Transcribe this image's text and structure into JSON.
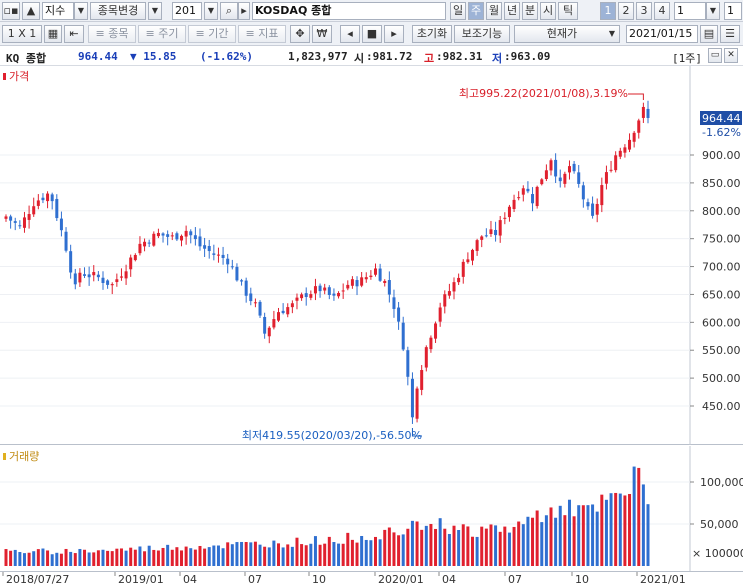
{
  "toolbar": {
    "type_select": "지수",
    "change_item_button": "종목변경",
    "code_value": "201",
    "index_name": "KOSDAQ 종합",
    "periods": [
      "일",
      "주",
      "월",
      "년",
      "분",
      "시",
      "틱"
    ],
    "active_period": "주",
    "numbers": [
      "1",
      "2",
      "3",
      "4"
    ],
    "active_number": "1",
    "unit_value": "1"
  },
  "toolbar2": {
    "layout_button": "1 X 1",
    "item_button": "종목",
    "cycle_button": "주기",
    "period_button": "기간",
    "indicator_button": "지표",
    "reset_button": "초기화",
    "aux_button": "보조기능",
    "price_type_button": "현재가",
    "date_value": "2021/01/15"
  },
  "quote": {
    "name": "KQ 종합",
    "price": "964.44",
    "change": "▼ 15.85",
    "change_pct": "(-1.62%)",
    "volume": "1,823,977",
    "open_label": "시",
    "open": ":981.72",
    "high_label": "고",
    "high": ":982.31",
    "low_label": "저",
    "low": ":963.09",
    "cycle_badge": "[1주]"
  },
  "price_pane": {
    "title": "가격",
    "current_label": "964.44",
    "current_pct": "-1.62%",
    "high_annotation": "최고995.22(2021/01/08),3.19%",
    "low_annotation": "최저419.55(2020/03/20),-56.50%",
    "y_ticks": [
      "900.00",
      "850.00",
      "800.00",
      "750.00",
      "700.00",
      "650.00",
      "600.00",
      "550.00",
      "500.00",
      "450.00"
    ]
  },
  "volume_pane": {
    "title": "거래량",
    "y_ticks": [
      "100,000",
      "50,000"
    ],
    "unit_label": "× 100000"
  },
  "x_axis": {
    "labels": [
      "2018/07/27",
      "2019/01",
      "04",
      "07",
      "10",
      "2020/01",
      "04",
      "07",
      "10",
      "2021/01"
    ]
  },
  "colors": {
    "up": "#e0202e",
    "down": "#2f6fd0",
    "accent": "#1a3fb8"
  },
  "chart_data": {
    "type": "candlestick",
    "period": "weekly",
    "start": "2018/07/27",
    "end": "2021/01/15",
    "ylim": [
      400,
      1000
    ],
    "volume_ylim": [
      0,
      130000
    ],
    "close_anchors": [
      [
        0,
        790
      ],
      [
        3,
        770
      ],
      [
        6,
        815
      ],
      [
        9,
        830
      ],
      [
        10,
        820
      ],
      [
        13,
        735
      ],
      [
        15,
        660
      ],
      [
        16,
        690
      ],
      [
        20,
        680
      ],
      [
        23,
        667
      ],
      [
        26,
        700
      ],
      [
        29,
        740
      ],
      [
        33,
        758
      ],
      [
        36,
        752
      ],
      [
        39,
        765
      ],
      [
        42,
        737
      ],
      [
        45,
        722
      ],
      [
        48,
        712
      ],
      [
        51,
        665
      ],
      [
        54,
        630
      ],
      [
        56,
        580
      ],
      [
        59,
        620
      ],
      [
        62,
        630
      ],
      [
        65,
        652
      ],
      [
        68,
        660
      ],
      [
        71,
        642
      ],
      [
        74,
        668
      ],
      [
        77,
        675
      ],
      [
        80,
        695
      ],
      [
        82,
        672
      ],
      [
        84,
        630
      ],
      [
        86,
        560
      ],
      [
        87,
        500
      ],
      [
        88,
        428
      ],
      [
        89,
        490
      ],
      [
        91,
        555
      ],
      [
        94,
        630
      ],
      [
        97,
        670
      ],
      [
        100,
        720
      ],
      [
        103,
        755
      ],
      [
        106,
        760
      ],
      [
        109,
        810
      ],
      [
        112,
        845
      ],
      [
        114,
        820
      ],
      [
        116,
        860
      ],
      [
        118,
        895
      ],
      [
        120,
        845
      ],
      [
        122,
        880
      ],
      [
        124,
        845
      ],
      [
        126,
        800
      ],
      [
        127,
        785
      ],
      [
        129,
        845
      ],
      [
        132,
        900
      ],
      [
        135,
        930
      ],
      [
        137,
        965
      ],
      [
        138,
        980
      ],
      [
        139,
        964
      ]
    ],
    "volume_anchors": [
      [
        0,
        17000
      ],
      [
        20,
        18000
      ],
      [
        40,
        23000
      ],
      [
        60,
        27000
      ],
      [
        70,
        31000
      ],
      [
        80,
        36000
      ],
      [
        86,
        47000
      ],
      [
        88,
        55000
      ],
      [
        92,
        51000
      ],
      [
        100,
        42000
      ],
      [
        110,
        45000
      ],
      [
        116,
        62000
      ],
      [
        120,
        74000
      ],
      [
        126,
        62000
      ],
      [
        132,
        80000
      ],
      [
        135,
        88000
      ],
      [
        137,
        110000
      ],
      [
        139,
        86000
      ]
    ]
  }
}
